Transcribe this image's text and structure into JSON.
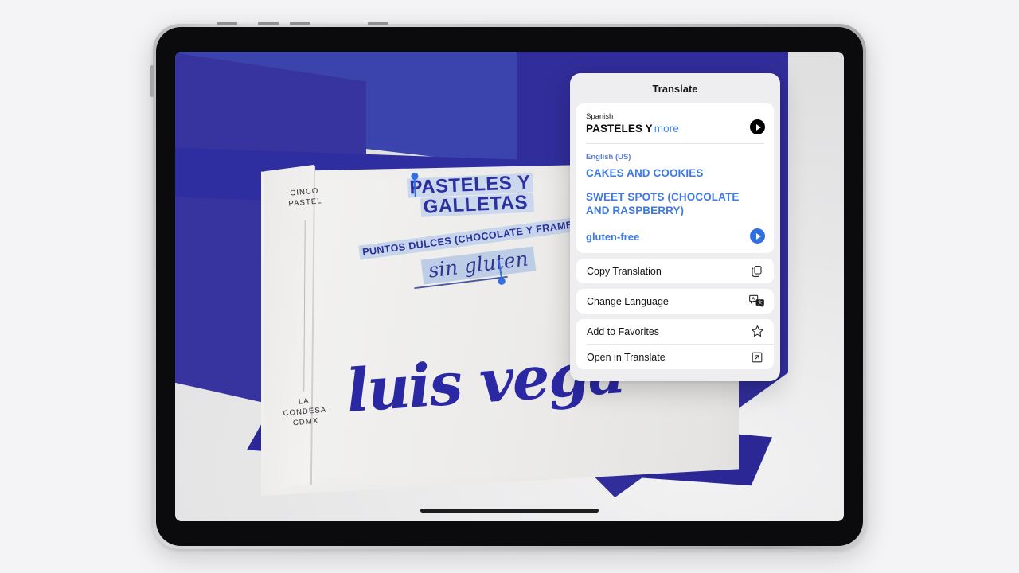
{
  "background": {
    "color": "#f4f4f6"
  },
  "device": {
    "name": "iPad",
    "frame_color": "#c3c5c8",
    "screen_bg": "#e8e8e9"
  },
  "packaging": {
    "brand": "luis vega",
    "side_top": "CINCO\nPASTEL",
    "side_top_line1": "CINCO",
    "side_top_line2": "PASTEL",
    "side_bottom_line1": "LA CONDESA",
    "side_bottom_line2": "CDMX",
    "headline_line1": "PASTELES Y",
    "headline_line2": "GALLETAS",
    "description": "PUNTOS DULCES (CHOCOLATE Y FRAMBUESA)",
    "script_note": "sin gluten",
    "box_blue": "#312d9b",
    "lid_blue": "#3b45ad",
    "panel_white": "#f1f0ee",
    "ink_blue": "#2c2f9e",
    "selection_highlight": "#c7d5ea",
    "selection_handle_color": "#2f6fe0"
  },
  "translate_popup": {
    "title": "Translate",
    "source": {
      "language_label": "Spanish",
      "text": "PASTELES Y",
      "more_label": "more",
      "play_button_color": "#000000"
    },
    "target": {
      "language_label": "English (US)",
      "lines": [
        "CAKES AND COOKIES",
        "SWEET SPOTS (CHOCOLATE AND RASPBERRY)"
      ],
      "line1": "CAKES AND COOKIES",
      "line2a": "SWEET SPOTS (CHOCOLATE",
      "line2b": "AND RASPBERRY)",
      "footer_text": "gluten-free",
      "play_button_color": "#2f6fe0",
      "accent_color": "#3e7ae0"
    },
    "menu": [
      {
        "label": "Copy Translation",
        "icon": "copy-icon"
      },
      {
        "label": "Change Language",
        "icon": "translate-bubbles-icon"
      },
      {
        "label": "Add to Favorites",
        "icon": "star-icon"
      },
      {
        "label": "Open in Translate",
        "icon": "open-external-icon"
      }
    ],
    "menu_items": {
      "copy": "Copy Translation",
      "change_language": "Change Language",
      "favorites": "Add to Favorites",
      "open": "Open in Translate"
    }
  }
}
